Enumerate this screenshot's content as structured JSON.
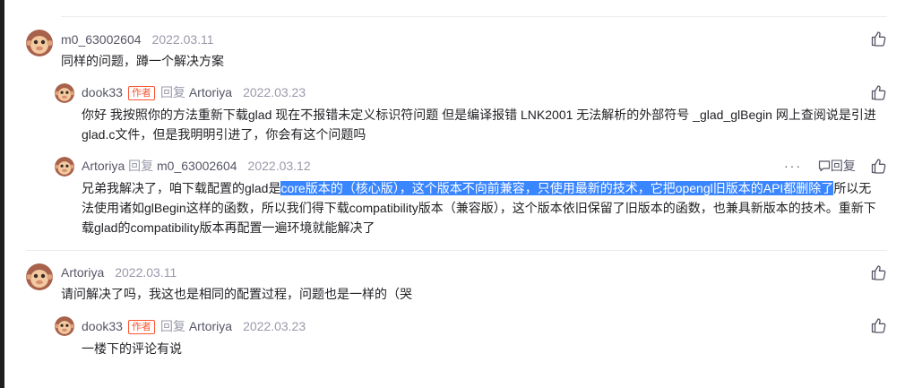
{
  "comments": [
    {
      "user": "m0_63002604",
      "date": "2022.03.11",
      "text": "同样的问题，蹲一个解决方案",
      "replies": [
        {
          "user": "dook33",
          "badge": "作者",
          "reply_word": "回复",
          "reply_to": "Artoriya",
          "date": "2022.03.23",
          "text_line1": "你好 我按照你的方法重新下载glad 现在不报错未定义标识符问题 但是编译报错 LNK2001 无法解析的外部符号 _glad_glBegin 网上查阅说是引进",
          "text_line2": "glad.c文件，但是我明明引进了，你会有这个问题吗"
        },
        {
          "user": "Artoriya",
          "reply_word": "回复",
          "reply_to": "m0_63002604",
          "date": "2022.03.12",
          "more_label": "···",
          "reply_label": "回复",
          "text_a": "兄弟我解决了，咱下载配置的glad是",
          "text_hl": "core版本的（核心版），这个版本不向前兼容，只使用最新的技术，它把opengl旧版本的API都删除了",
          "text_b": "所以无",
          "text_line2": "法使用诸如glBegin这样的函数，所以我们得下载compatibility版本（兼容版），这个版本依旧保留了旧版本的函数，也兼具新版本的技术。重新下",
          "text_line3": "载glad的compatibility版本再配置一遍环境就能解决了"
        }
      ]
    },
    {
      "user": "Artoriya",
      "date": "2022.03.11",
      "text": "请问解决了吗，我这也是相同的配置过程，问题也是一样的（哭",
      "replies": [
        {
          "user": "dook33",
          "badge": "作者",
          "reply_word": "回复",
          "reply_to": "Artoriya",
          "date": "2022.03.23",
          "text": "一楼下的评论有说"
        }
      ]
    }
  ],
  "icons": {
    "avatar": "monkey-avatar-icon",
    "like": "thumbs-up-icon",
    "reply": "comment-icon",
    "more": "more-dots-icon"
  },
  "colors": {
    "highlight": "#3a86ff",
    "badge": "#fc5531",
    "meta": "#555666",
    "muted": "#999aaa"
  }
}
